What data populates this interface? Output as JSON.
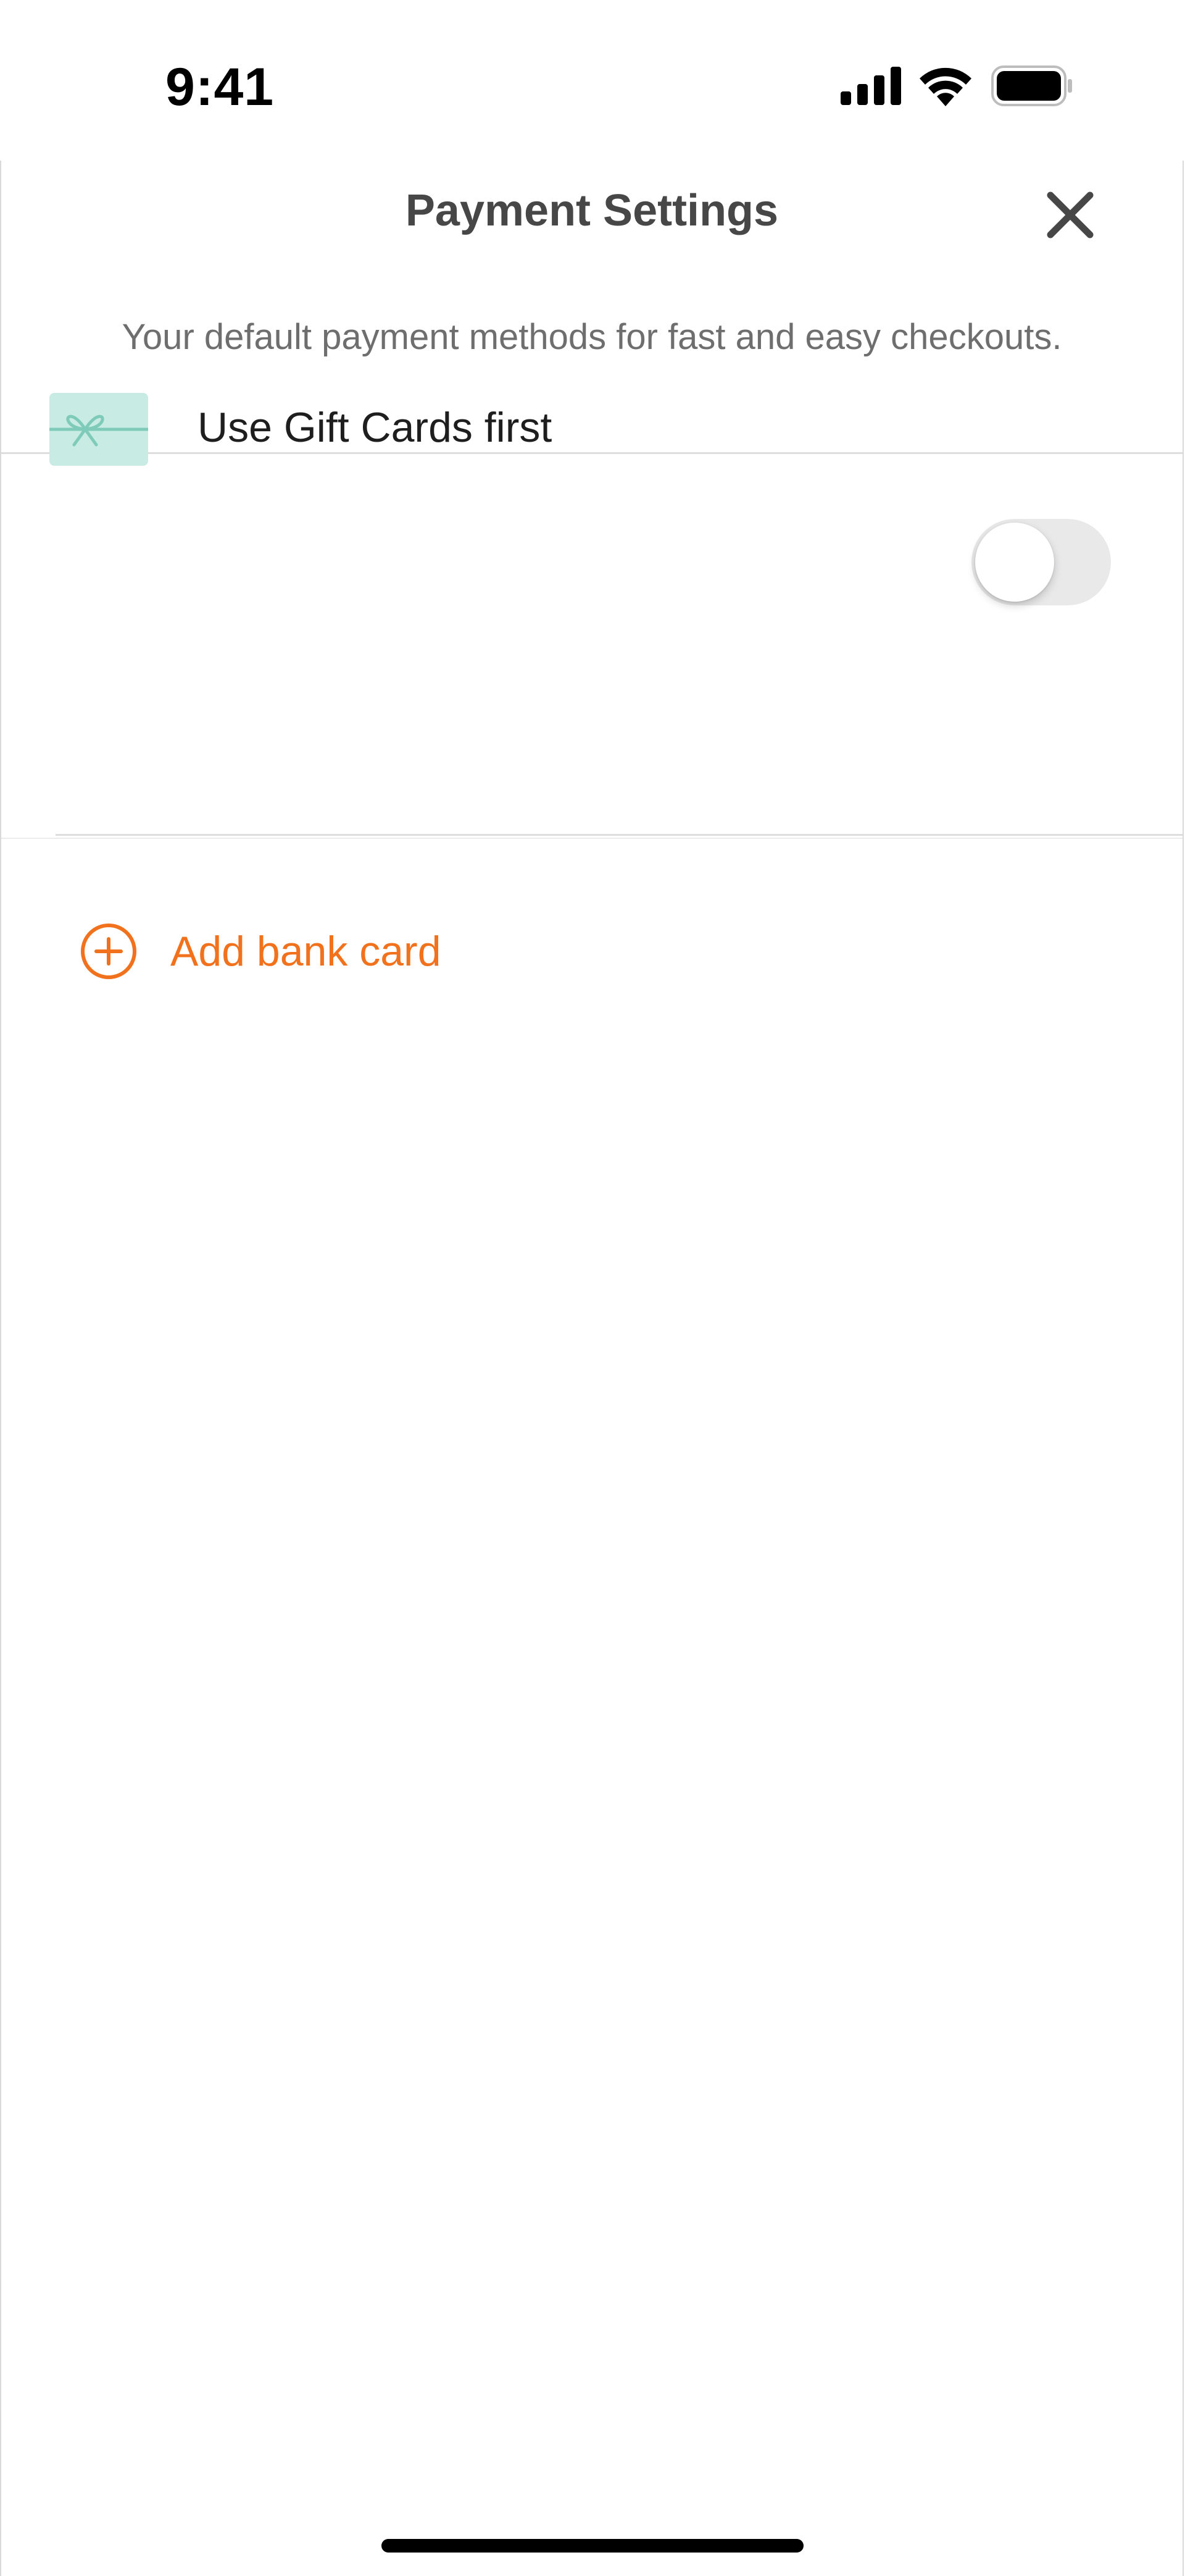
{
  "status_bar": {
    "time": "9:41",
    "icons": [
      "signal-icon",
      "wifi-icon",
      "battery-icon"
    ]
  },
  "sheet": {
    "title": "Payment Settings",
    "close_icon": "close-icon",
    "subtitle": "Your default payment methods for fast and easy checkouts."
  },
  "gift_cards": {
    "icon": "gift-card-icon",
    "label": "Use Gift Cards first",
    "toggle_on": false
  },
  "add_card": {
    "icon": "plus-circle-icon",
    "label": "Add bank card"
  },
  "colors": {
    "accent": "#f2711c",
    "gift_icon_bg": "#c8ebe3",
    "gift_icon_ribbon": "#7fcbb9",
    "title_text": "#474747",
    "subtitle_text": "#6e6e6e",
    "toggle_off_track": "#e9e9ea"
  }
}
